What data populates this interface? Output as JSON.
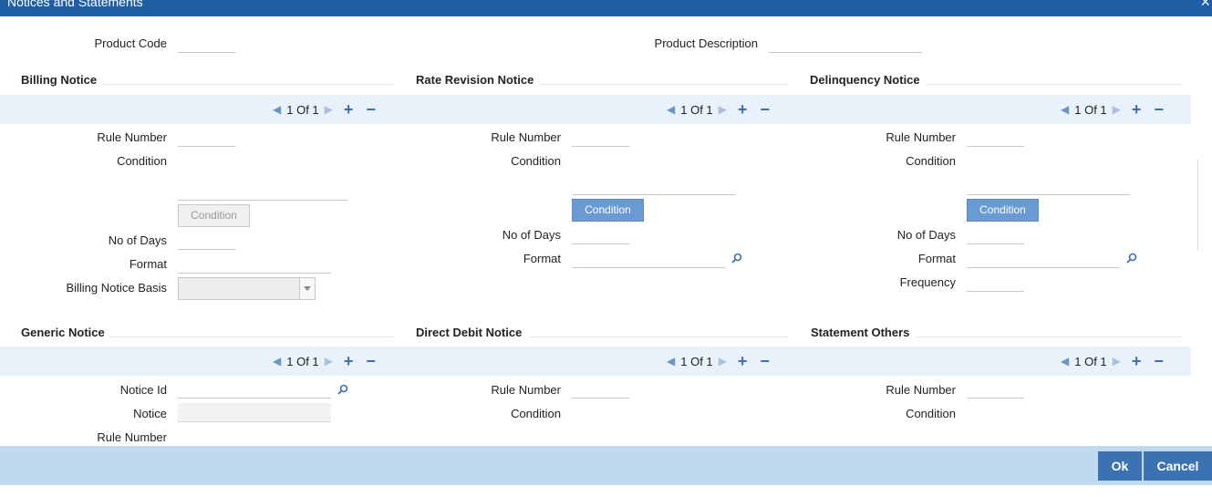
{
  "window": {
    "title": "Notices and Statements",
    "close_glyph": "×"
  },
  "header": {
    "product_code_label": "Product Code",
    "product_description_label": "Product Description"
  },
  "billing": {
    "title": "Billing Notice",
    "pager": "1 Of 1",
    "rule_number_label": "Rule Number",
    "condition_label": "Condition",
    "condition_button": "Condition",
    "no_of_days_label": "No of Days",
    "format_label": "Format",
    "basis_label": "Billing Notice Basis"
  },
  "rate_revision": {
    "title": "Rate Revision Notice",
    "pager": "1 Of 1",
    "rule_number_label": "Rule Number",
    "condition_label": "Condition",
    "condition_button": "Condition",
    "no_of_days_label": "No of Days",
    "format_label": "Format"
  },
  "delinquency": {
    "title": "Delinquency Notice",
    "pager": "1 Of 1",
    "rule_number_label": "Rule Number",
    "condition_label": "Condition",
    "condition_button": "Condition",
    "no_of_days_label": "No of Days",
    "format_label": "Format",
    "frequency_label": "Frequency"
  },
  "generic": {
    "title": "Generic Notice",
    "pager": "1 Of 1",
    "notice_id_label": "Notice Id",
    "notice_label": "Notice",
    "rule_number_label": "Rule Number"
  },
  "direct_debit": {
    "title": "Direct Debit Notice",
    "pager": "1 Of 1",
    "rule_number_label": "Rule Number",
    "condition_label": "Condition"
  },
  "statement_others": {
    "title": "Statement Others",
    "pager": "1 Of 1",
    "rule_number_label": "Rule Number",
    "condition_label": "Condition"
  },
  "nav_glyphs": {
    "prev": "◀",
    "next": "▶",
    "add": "+",
    "remove": "−"
  },
  "footer": {
    "ok_label": "Ok",
    "cancel_label": "Cancel"
  },
  "colors": {
    "titlebar": "#1f5fa6",
    "accent_button": "#6a9ad4",
    "footer": "#c0d9ef",
    "footer_button": "#3b72b2"
  },
  "icons": {
    "lookup": "magnifier-icon",
    "close": "close-icon",
    "dropdown": "chevron-down-icon"
  }
}
